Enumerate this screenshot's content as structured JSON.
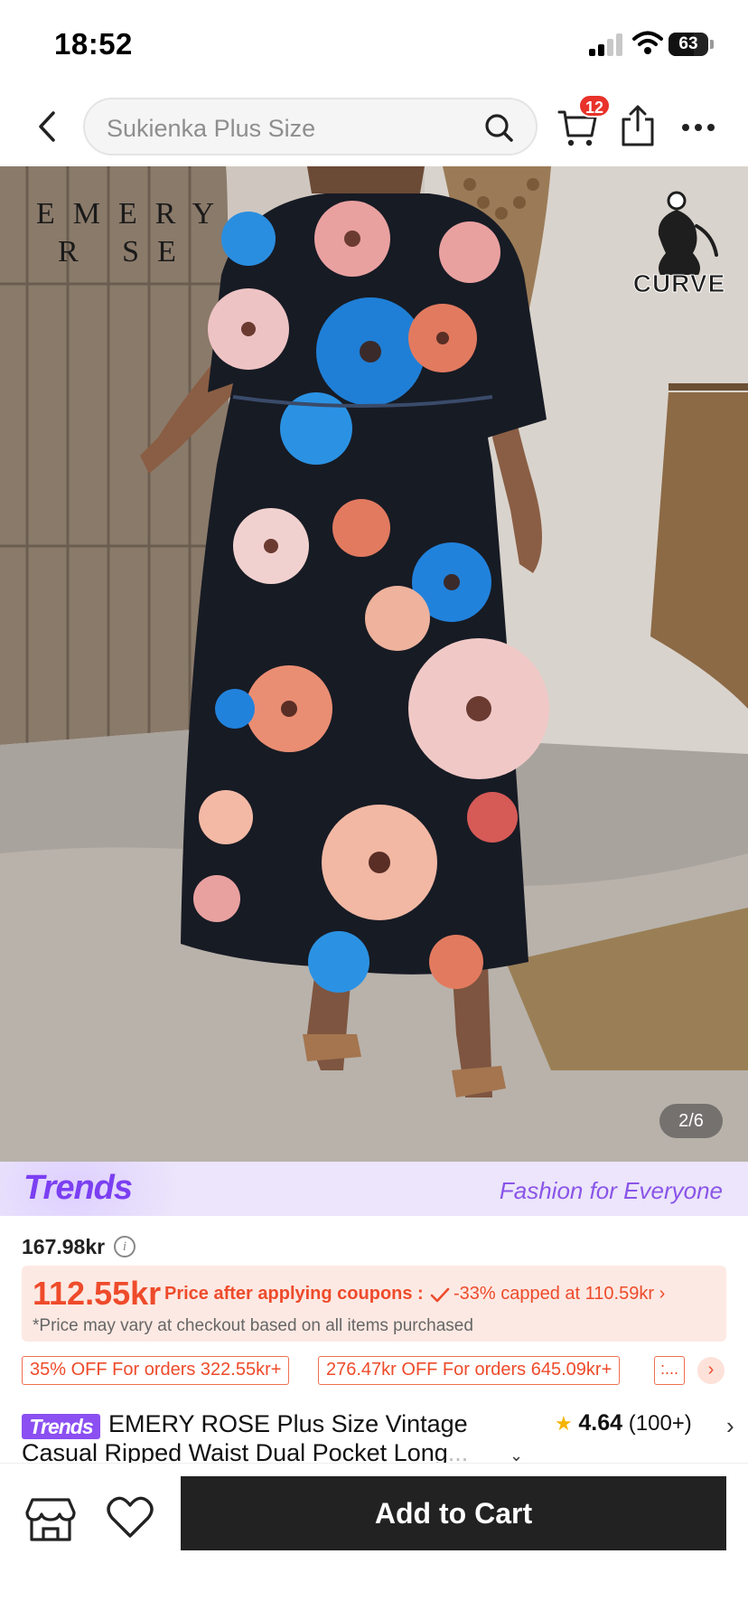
{
  "status_bar": {
    "time": "18:52",
    "battery": "63"
  },
  "header": {
    "search_placeholder": "Sukienka Plus Size",
    "cart_count": "12",
    "icons": [
      "back-icon",
      "search-icon",
      "cart-icon",
      "share-icon",
      "more-icon"
    ]
  },
  "product_image": {
    "brand_line1": "EMERY",
    "brand_line2": "R  SE",
    "curve_label": "CURVE",
    "counter": "2/6"
  },
  "trends_banner": {
    "logo": "Trends",
    "tagline": "Fashion for Everyone"
  },
  "price": {
    "original": "167.98kr",
    "sale": "112.55kr",
    "coupon_label": "Price after applying coupons :",
    "coupon_detail": "-33% capped at 110.59kr",
    "note": "*Price may vary at checkout based on all items purchased"
  },
  "promos": [
    "35% OFF For orders 322.55kr+",
    "276.47kr OFF For orders 645.09kr+",
    ":..."
  ],
  "product": {
    "tag": "Trends",
    "title_line1": "EMERY ROSE Plus Size Vintage",
    "title_line2": "Casual Ripped Waist Dual Pocket Long",
    "title_ellipsis": "...",
    "rating": "4.64",
    "rating_count": "(100+)"
  },
  "bottom_bar": {
    "add_to_cart": "Add to Cart"
  },
  "colors": {
    "accent_red": "#ee4b2b",
    "trends_purple": "#7b3ff2",
    "button_dark": "#222222"
  }
}
